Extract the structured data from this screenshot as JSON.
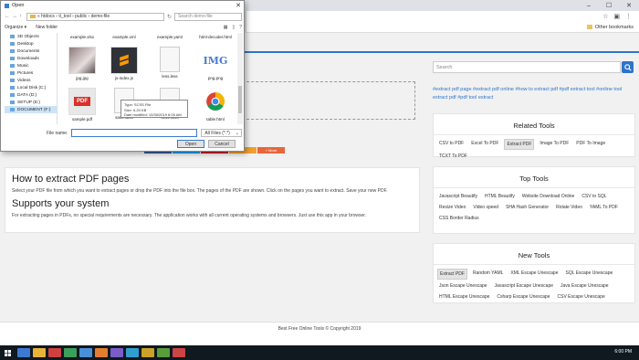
{
  "dialog": {
    "title": "Open",
    "breadcrumb": "« htdocs › ti_tool › public › demo-file",
    "search_placeholder": "Search demo-file",
    "organize": "Organize ▾",
    "new_folder": "New folder",
    "nav_items": [
      "3D Objects",
      "Desktop",
      "Documents",
      "Downloads",
      "Music",
      "Pictures",
      "Videos",
      "Local Disk (C:)",
      "DATA (D:)",
      "SETUP (E:)",
      "DOCUMENT (F:)"
    ],
    "files": [
      {
        "name": "example.xlsx",
        "icon": "excel-icon"
      },
      {
        "name": "example.xml",
        "icon": "xml-icon"
      },
      {
        "name": "example.yaml",
        "icon": "yaml-icon"
      },
      {
        "name": "html-decoder.html",
        "icon": "html-icon"
      },
      {
        "name": "jpg.jpg",
        "icon": "photo-icon"
      },
      {
        "name": "js-index.js",
        "icon": "sublime-icon"
      },
      {
        "name": "less.less",
        "icon": "document-icon"
      },
      {
        "name": "png.png",
        "icon": "img-logo-icon"
      },
      {
        "name": "sample.pdf",
        "icon": "pdf-icon"
      },
      {
        "name": "sass.sass",
        "icon": "document-icon"
      },
      {
        "name": "scss.scss",
        "icon": "document-icon"
      },
      {
        "name": "table.html",
        "icon": "chrome-icon"
      }
    ],
    "tooltip": {
      "line1": "Type: SCSS File",
      "line2": "Size: 6.20 KB",
      "line3": "Date modified: 10/30/2019 6:05 AM"
    },
    "file_name_label": "File name:",
    "file_name_value": "",
    "file_type": "All Files (*.*)",
    "open_label": "Open",
    "cancel_label": "Cancel"
  },
  "browser": {
    "other_bookmarks": "Other bookmarks"
  },
  "search": {
    "placeholder": "Search"
  },
  "tags": "#extract pdf page #extract pdf online #how to extract pdf #pdf extract tool #online tool extract pdf #pdf tool extract",
  "share_buttons": [
    {
      "label": "",
      "color": "#3b5998"
    },
    {
      "label": "",
      "color": "#1da1f2"
    },
    {
      "label": "",
      "color": "#cb2027"
    },
    {
      "label": "",
      "color": "#f0a030"
    },
    {
      "label": "+ More",
      "color": "#e8663a"
    }
  ],
  "main": {
    "h1": "How to extract PDF pages",
    "p1": "Select your PDF file from which you want to extract pages or drop the PDF into the file box. The pages of the PDF are shown. Click on the pages you want to extract. Save your new PDF.",
    "h2": "Supports your system",
    "p2": "For extracting pages in PDFs, no special requirements are necessary. The application works with all current operating systems and browsers. Just use this app in your browser."
  },
  "related_tools": {
    "title": "Related Tools",
    "items": [
      "CSV to PDF",
      "Excel To PDF",
      "Extract PDF",
      "Image To PDF",
      "PDF To Image",
      "TCXT To PDF"
    ],
    "active": "Extract PDF"
  },
  "top_tools": {
    "title": "Top Tools",
    "items": [
      "Javascript Beautify",
      "HTML Beautify",
      "Website Download Online",
      "CSV to SQL",
      "Resize Video",
      "Video speed",
      "SHA Hash Generator",
      "Rotate Video",
      "YAML To PDF",
      "CSS Border Radius"
    ]
  },
  "new_tools": {
    "title": "New Tools",
    "items": [
      "Extract PDF",
      "Random YAML",
      "XML Escape Unescape",
      "SQL Escape Unescape",
      "Json Escape Unescape",
      "Javascript Escape Unescape",
      "Java Escape Unescape",
      "HTML Escape Unescape",
      "Csharp Escape Unescape",
      "CSV Escape Unescape"
    ],
    "active": "Extract PDF"
  },
  "footer": "Best Free Online Tools © Copyright 2019",
  "taskbar": {
    "clock": "6:00 PM",
    "apps": [
      "#3b7ad0",
      "#e8b339",
      "#d04040",
      "#3aa05a",
      "#4a90d9",
      "#e37e2e",
      "#7b5cc9",
      "#2f9fd0",
      "#c9a227",
      "#5a9e3a",
      "#cc4444"
    ]
  }
}
